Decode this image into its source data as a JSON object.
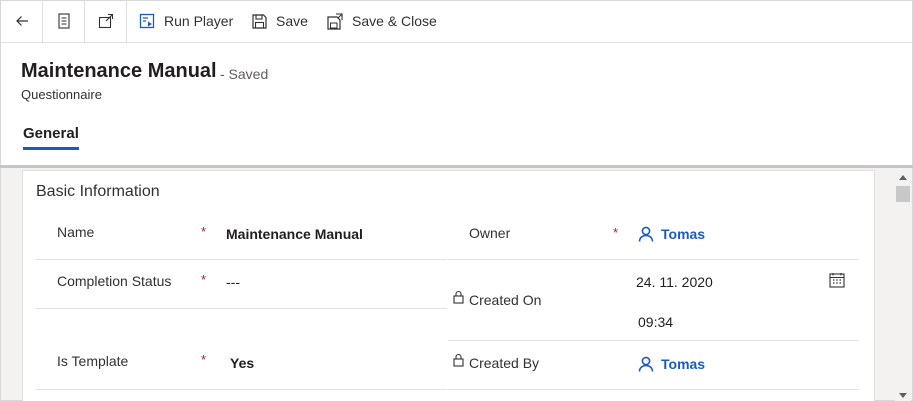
{
  "command_bar": {
    "run_player": "Run Player",
    "save": "Save",
    "save_close": "Save & Close"
  },
  "header": {
    "title": "Maintenance Manual",
    "status": "- Saved",
    "entity": "Questionnaire"
  },
  "tabs": [
    {
      "label": "General",
      "selected": true
    }
  ],
  "section": {
    "title": "Basic Information",
    "fields": {
      "name": {
        "label": "Name",
        "value": "Maintenance Manual",
        "required": "*"
      },
      "completion_status": {
        "label": "Completion Status",
        "value": "---",
        "required": "*"
      },
      "is_template": {
        "label": "Is Template",
        "value": "Yes",
        "required": "*"
      },
      "owner": {
        "label": "Owner",
        "value": "Tomas",
        "required": "*"
      },
      "created_on": {
        "label": "Created On",
        "date": "24. 11. 2020",
        "time": "09:34"
      },
      "created_by": {
        "label": "Created By",
        "value": "Tomas"
      }
    }
  },
  "icons": {
    "back": "arrow-left-icon",
    "form": "form-icon",
    "popout": "popout-icon",
    "run_player": "run-player-icon",
    "save": "save-icon",
    "save_close": "save-close-icon",
    "lock": "lock-icon",
    "user": "user-icon",
    "calendar": "calendar-icon"
  },
  "colors": {
    "accent": "#1b5bbf",
    "required": "#a4262c"
  }
}
